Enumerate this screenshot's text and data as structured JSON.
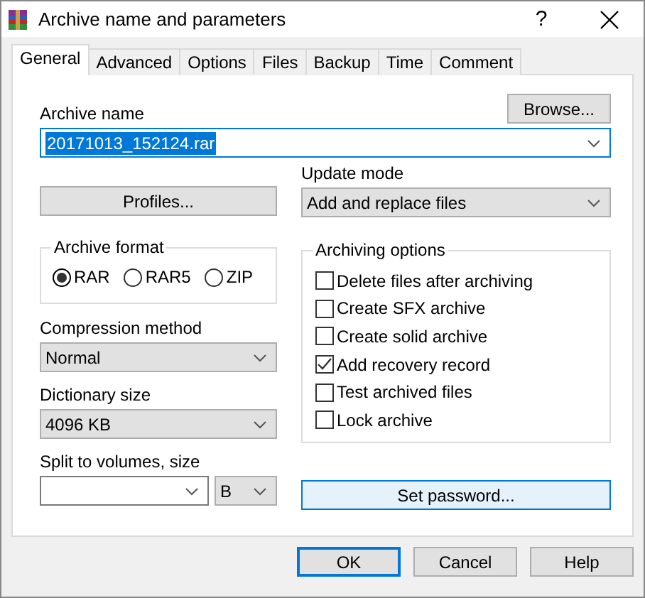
{
  "window": {
    "title": "Archive name and parameters",
    "help": "?"
  },
  "tabs": [
    {
      "label": "General",
      "selected": true
    },
    {
      "label": "Advanced",
      "selected": false
    },
    {
      "label": "Options",
      "selected": false
    },
    {
      "label": "Files",
      "selected": false
    },
    {
      "label": "Backup",
      "selected": false
    },
    {
      "label": "Time",
      "selected": false
    },
    {
      "label": "Comment",
      "selected": false
    }
  ],
  "archive_name": {
    "label": "Archive name",
    "value": "20171013_152124.rar",
    "highlighted": true
  },
  "browse_button": "Browse...",
  "profiles_button": "Profiles...",
  "update_mode": {
    "label": "Update mode",
    "value": "Add and replace files"
  },
  "archive_format": {
    "title": "Archive format",
    "options": [
      {
        "label": "RAR",
        "selected": true
      },
      {
        "label": "RAR5",
        "selected": false
      },
      {
        "label": "ZIP",
        "selected": false
      }
    ]
  },
  "compression_method": {
    "label": "Compression method",
    "value": "Normal"
  },
  "dictionary_size": {
    "label": "Dictionary size",
    "value": "4096 KB"
  },
  "split_volumes": {
    "label": "Split to volumes, size",
    "unit": "B"
  },
  "archiving_options": {
    "title": "Archiving options",
    "items": [
      {
        "label": "Delete files after archiving",
        "checked": false
      },
      {
        "label": "Create SFX archive",
        "checked": false
      },
      {
        "label": "Create solid archive",
        "checked": false
      },
      {
        "label": "Add recovery record",
        "checked": true
      },
      {
        "label": "Test archived files",
        "checked": false
      },
      {
        "label": "Lock archive",
        "checked": false
      }
    ]
  },
  "set_password_button": {
    "label": "Set password...",
    "focused": true
  },
  "buttons": [
    {
      "label": "OK",
      "default": true
    },
    {
      "label": "Cancel",
      "default": false
    },
    {
      "label": "Help",
      "default": false
    }
  ]
}
